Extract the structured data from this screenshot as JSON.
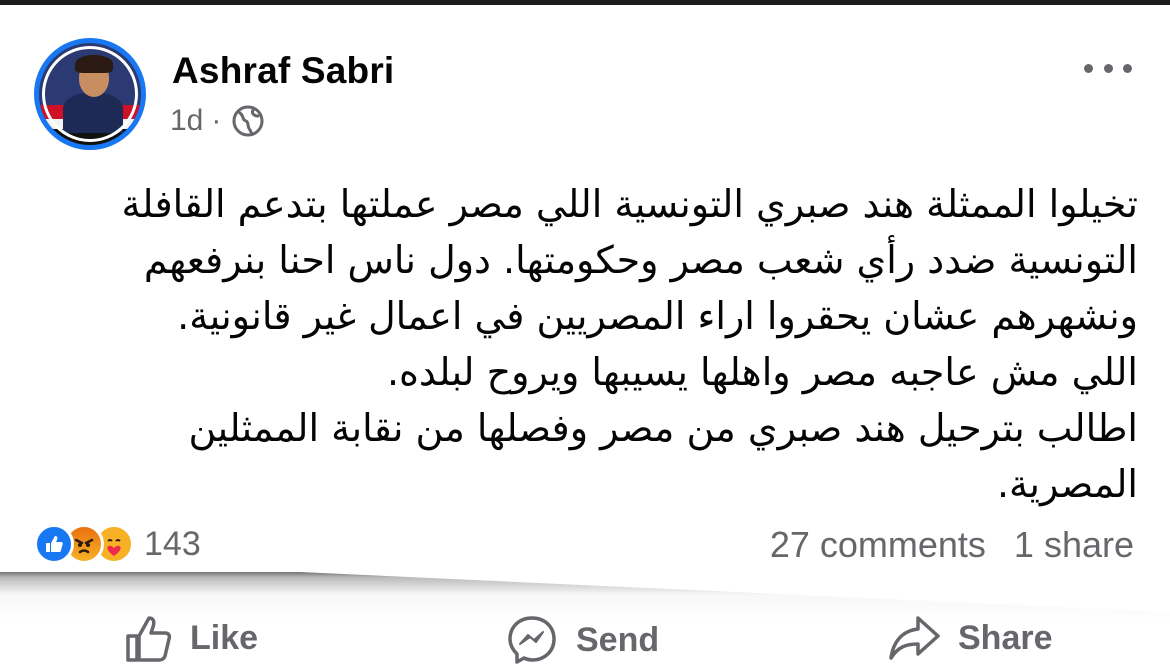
{
  "post": {
    "author": "Ashraf Sabri",
    "time": "1d",
    "separator": "·",
    "audience_icon": "globe-icon",
    "more_icon": "more-options-icon",
    "text_lines": [
      "تخيلوا الممثلة هند صبري التونسية اللي مصر عملتها بتدعم القافلة",
      "التونسية ضدد رأي شعب مصر وحكومتها. دول ناس احنا بنرفعهم",
      "ونشهرهم عشان يحقروا اراء المصريين في اعمال غير قانونية.",
      "اللي مش عاجبه مصر واهلها يسيبها ويروح لبلده.",
      "اطالب بترحيل هند صبري من مصر وفصلها من نقابة الممثلين",
      "المصرية."
    ]
  },
  "engagement": {
    "reaction_icons": [
      "like-icon",
      "angry-icon",
      "care-icon"
    ],
    "reaction_count": "143",
    "comments": "27 comments",
    "shares": "1 share"
  },
  "actions": {
    "like": "Like",
    "send": "Send",
    "share": "Share"
  },
  "colors": {
    "accent": "#1877f2",
    "secondary_text": "#65676b",
    "primary_text": "#050505"
  }
}
